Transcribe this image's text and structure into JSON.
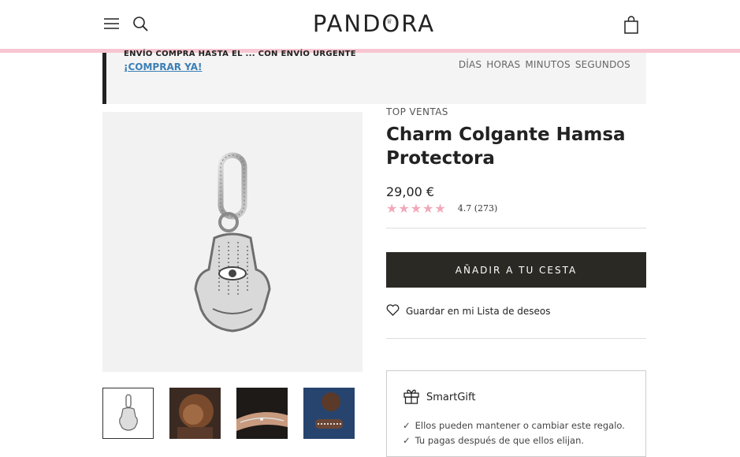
{
  "header": {
    "brand": "PANDORA",
    "brand_mark": "♕",
    "icons": [
      "menu-icon",
      "search-icon",
      "shopping-bag-icon"
    ]
  },
  "promo": {
    "cut_text": "ENVÍO COMPRA HASTA EL ... CON ENVÍO URGENTE",
    "cta": "¡COMPRAR YA!",
    "countdown": [
      "DÍAS",
      "HORAS",
      "MINUTOS",
      "SEGUNDOS"
    ]
  },
  "product": {
    "category": "TOP VENTAS",
    "title": "Charm Colgante Hamsa Protectora",
    "price": "29,00 €",
    "stars": "★★★★★",
    "rating_text": "4.7  (273)",
    "add_to_cart": "AÑADIR A TU CESTA",
    "wishlist": "Guardar en mi Lista de deseos"
  },
  "smartgift": {
    "title": "SmartGift",
    "check": "✓",
    "items": [
      "Ellos pueden mantener o cambiar este regalo.",
      "Tu pagas después de que ellos elijan."
    ]
  },
  "colors": {
    "accent_pink": "#f7c6d0",
    "star_pink": "#f2a8b8",
    "button_dark": "#2b2924",
    "link_blue": "#3a7fb6"
  }
}
